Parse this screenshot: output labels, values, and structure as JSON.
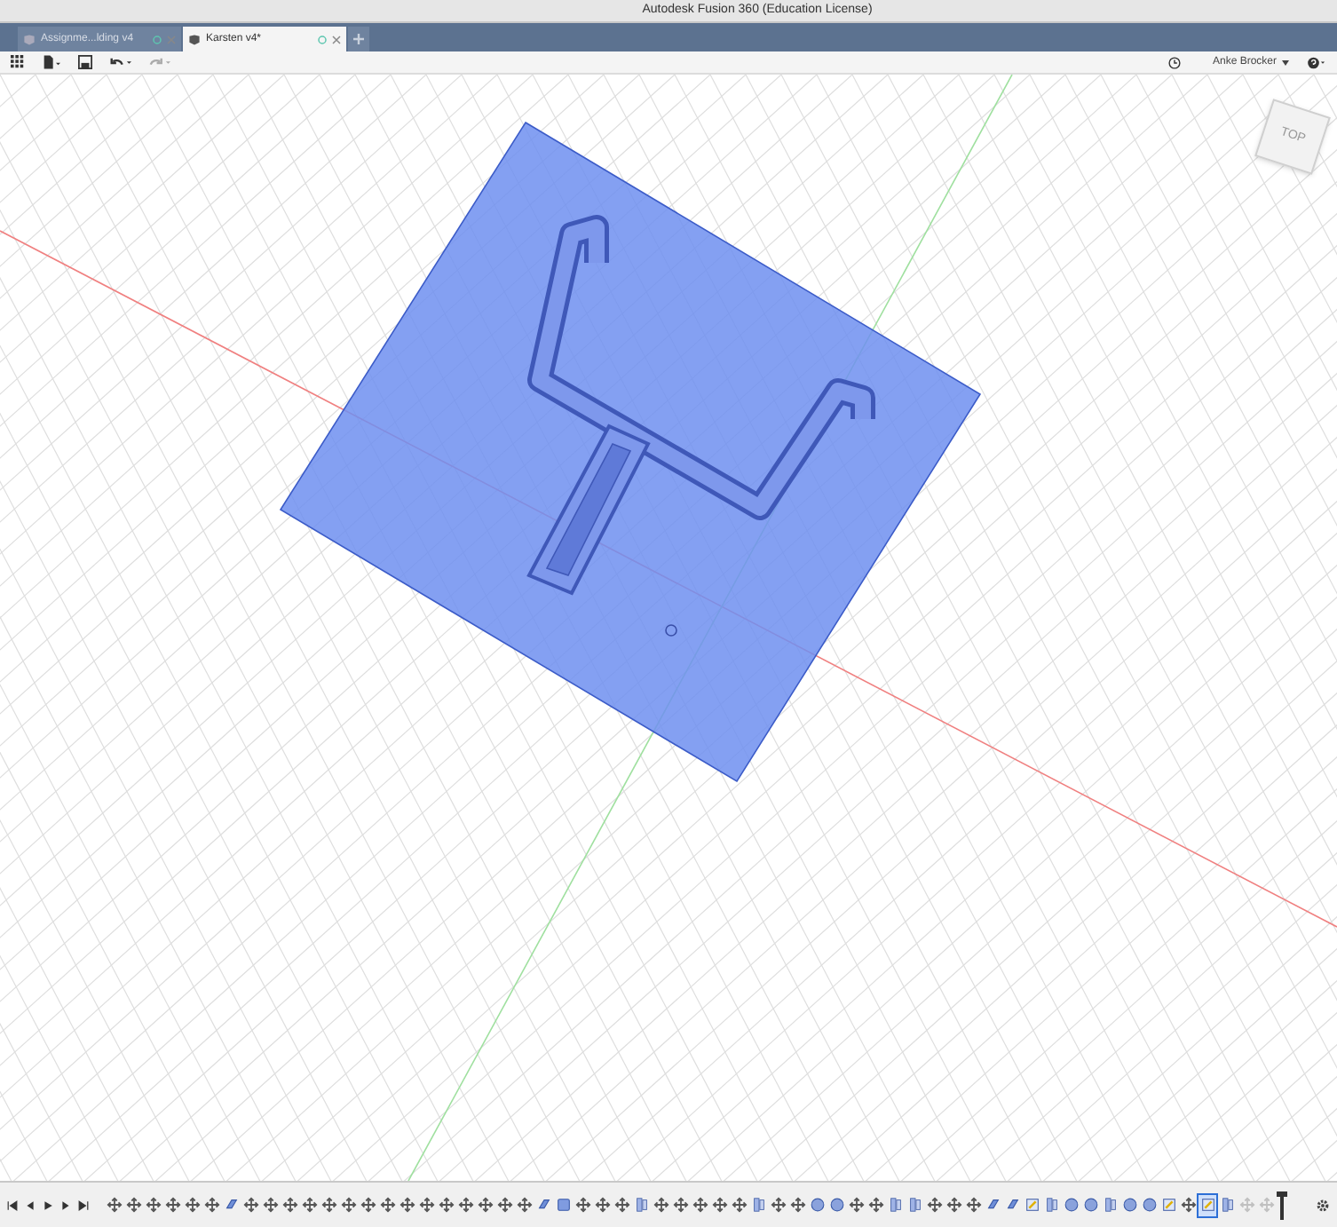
{
  "window": {
    "title": "Autodesk Fusion 360 (Education License)"
  },
  "tabs": [
    {
      "label": "Assignme...lding v4",
      "selected": false
    },
    {
      "label": "Karsten v4*",
      "selected": true
    }
  ],
  "user": {
    "name": "Anke Brocker"
  },
  "viewcube": {
    "face": "TOP"
  },
  "timeline": [
    {
      "kind": "move",
      "selected": false,
      "disabled": false
    },
    {
      "kind": "move",
      "selected": false,
      "disabled": false
    },
    {
      "kind": "move",
      "selected": false,
      "disabled": false
    },
    {
      "kind": "move",
      "selected": false,
      "disabled": false
    },
    {
      "kind": "move",
      "selected": false,
      "disabled": false
    },
    {
      "kind": "move",
      "selected": false,
      "disabled": false
    },
    {
      "kind": "extrude",
      "selected": false,
      "disabled": false
    },
    {
      "kind": "move",
      "selected": false,
      "disabled": false
    },
    {
      "kind": "move",
      "selected": false,
      "disabled": false
    },
    {
      "kind": "move",
      "selected": false,
      "disabled": false
    },
    {
      "kind": "move",
      "selected": false,
      "disabled": false
    },
    {
      "kind": "move",
      "selected": false,
      "disabled": false
    },
    {
      "kind": "move",
      "selected": false,
      "disabled": false
    },
    {
      "kind": "move",
      "selected": false,
      "disabled": false
    },
    {
      "kind": "move",
      "selected": false,
      "disabled": false
    },
    {
      "kind": "move",
      "selected": false,
      "disabled": false
    },
    {
      "kind": "move",
      "selected": false,
      "disabled": false
    },
    {
      "kind": "move",
      "selected": false,
      "disabled": false
    },
    {
      "kind": "move",
      "selected": false,
      "disabled": false
    },
    {
      "kind": "move",
      "selected": false,
      "disabled": false
    },
    {
      "kind": "move",
      "selected": false,
      "disabled": false
    },
    {
      "kind": "move",
      "selected": false,
      "disabled": false
    },
    {
      "kind": "extrude",
      "selected": false,
      "disabled": false
    },
    {
      "kind": "box",
      "selected": false,
      "disabled": false
    },
    {
      "kind": "move",
      "selected": false,
      "disabled": false
    },
    {
      "kind": "move",
      "selected": false,
      "disabled": false
    },
    {
      "kind": "move",
      "selected": false,
      "disabled": false
    },
    {
      "kind": "body",
      "selected": false,
      "disabled": false
    },
    {
      "kind": "move",
      "selected": false,
      "disabled": false
    },
    {
      "kind": "move",
      "selected": false,
      "disabled": false
    },
    {
      "kind": "move",
      "selected": false,
      "disabled": false
    },
    {
      "kind": "move",
      "selected": false,
      "disabled": false
    },
    {
      "kind": "move",
      "selected": false,
      "disabled": false
    },
    {
      "kind": "body",
      "selected": false,
      "disabled": false
    },
    {
      "kind": "move",
      "selected": false,
      "disabled": false
    },
    {
      "kind": "move",
      "selected": false,
      "disabled": false
    },
    {
      "kind": "sphere",
      "selected": false,
      "disabled": false
    },
    {
      "kind": "sphere",
      "selected": false,
      "disabled": false
    },
    {
      "kind": "move",
      "selected": false,
      "disabled": false
    },
    {
      "kind": "move",
      "selected": false,
      "disabled": false
    },
    {
      "kind": "body",
      "selected": false,
      "disabled": false
    },
    {
      "kind": "body",
      "selected": false,
      "disabled": false
    },
    {
      "kind": "move",
      "selected": false,
      "disabled": false
    },
    {
      "kind": "move",
      "selected": false,
      "disabled": false
    },
    {
      "kind": "move",
      "selected": false,
      "disabled": false
    },
    {
      "kind": "extrude",
      "selected": false,
      "disabled": false
    },
    {
      "kind": "extrude",
      "selected": false,
      "disabled": false
    },
    {
      "kind": "sketch",
      "selected": false,
      "disabled": false
    },
    {
      "kind": "body",
      "selected": false,
      "disabled": false
    },
    {
      "kind": "sphere",
      "selected": false,
      "disabled": false
    },
    {
      "kind": "sphere",
      "selected": false,
      "disabled": false
    },
    {
      "kind": "body",
      "selected": false,
      "disabled": false
    },
    {
      "kind": "sphere",
      "selected": false,
      "disabled": false
    },
    {
      "kind": "sphere",
      "selected": false,
      "disabled": false
    },
    {
      "kind": "sketch",
      "selected": false,
      "disabled": false
    },
    {
      "kind": "move",
      "selected": false,
      "disabled": false
    },
    {
      "kind": "sketch",
      "selected": true,
      "disabled": false
    },
    {
      "kind": "body",
      "selected": false,
      "disabled": false
    },
    {
      "kind": "move",
      "selected": false,
      "disabled": true
    },
    {
      "kind": "move",
      "selected": false,
      "disabled": true
    }
  ]
}
